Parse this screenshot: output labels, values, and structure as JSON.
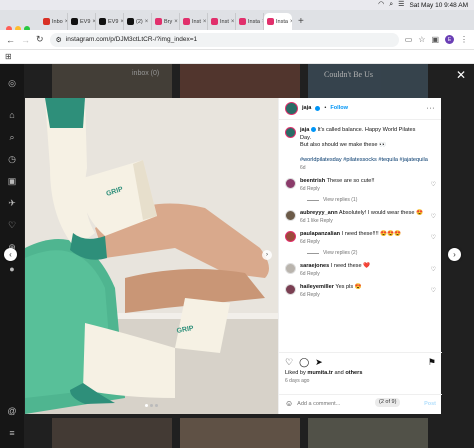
{
  "menubar": {
    "datetime": "Sat May 10  9:48 AM"
  },
  "tabs": [
    {
      "label": "Inbo",
      "color": "#d93025"
    },
    {
      "label": "EV9",
      "color": "#111111"
    },
    {
      "label": "EV9",
      "color": "#111111"
    },
    {
      "label": "(2)",
      "color": "#111111"
    },
    {
      "label": "Bry",
      "color": "#e1306c"
    },
    {
      "label": "Inst",
      "color": "#e1306c"
    },
    {
      "label": "Inst",
      "color": "#e1306c"
    },
    {
      "label": "Insta",
      "color": "#e1306c"
    },
    {
      "label": "Insta",
      "color": "#e1306c"
    }
  ],
  "address": {
    "url": "instagram.com/p/DJM3ctLtCR-/?img_index=1",
    "profile_initial": "E"
  },
  "post": {
    "username": "jaja",
    "follow": "Follow",
    "caption_user": "jaja",
    "caption": "It's called balance. Happy World Pilates Day.",
    "caption2": "But also should we make these 👀",
    "hashtags": "#worldpilatesday #pilatessocks #tequila #jajatequila",
    "caption_age": "6d"
  },
  "comments": [
    {
      "user": "beentrish",
      "text": "These are so cute!!",
      "meta": "6d   Reply",
      "replies": "View replies (1)",
      "avatar": "#8a3b6a"
    },
    {
      "user": "aubreyyy_ann",
      "text": "Absolutely! I would wear these 😍",
      "meta": "6d   1 like   Reply",
      "replies": "",
      "avatar": "#6b5a48"
    },
    {
      "user": "paulapanzalian",
      "text": "I need these!!!! 😍😍😍",
      "meta": "6d   Reply",
      "replies": "View replies (2)",
      "avatar": "#9c4a3a"
    },
    {
      "user": "saraejones",
      "text": "I need these ❤️",
      "meta": "6d   Reply",
      "replies": "",
      "avatar": "#b9b4ad"
    },
    {
      "user": "haileyemiller",
      "text": "Yes pls 😍",
      "meta": "6d   Reply",
      "replies": "",
      "avatar": "#7a3f52"
    }
  ],
  "actions": {
    "liked_by_prefix": "Liked by ",
    "liked_by_user": "mumita.tr",
    "liked_by_suffix": " and ",
    "liked_by_others": "others",
    "age": "6 days ago"
  },
  "add_comment": {
    "placeholder": "Add a comment...",
    "pager": "(2 of 9)",
    "post": "Post"
  },
  "background": {
    "tile1": "inbox (0)",
    "tile2": "Couldn't Be Us"
  }
}
